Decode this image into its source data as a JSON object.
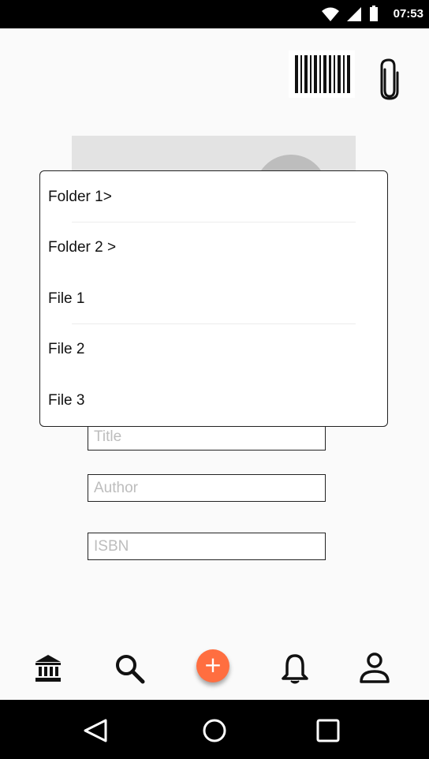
{
  "status_bar": {
    "time": "07:53",
    "icons": [
      "wifi-icon",
      "signal-icon",
      "battery-icon"
    ]
  },
  "top_actions": {
    "barcode_icon": "barcode-icon",
    "attach_icon": "paperclip-icon"
  },
  "dropdown_menu": {
    "items": [
      {
        "label": "Folder 1>"
      },
      {
        "label": "Folder 2 >"
      },
      {
        "label": "File 1"
      },
      {
        "label": "File 2"
      },
      {
        "label": "File 3"
      }
    ]
  },
  "form": {
    "title_placeholder": "Title",
    "author_placeholder": "Author",
    "isbn_placeholder": "ISBN"
  },
  "bottom_nav": {
    "items": [
      "library-icon",
      "search-icon",
      "add-icon",
      "bell-icon",
      "profile-icon"
    ],
    "fab_label": "+",
    "fab_color": "#ff6e40"
  },
  "system_nav": [
    "back-icon",
    "home-icon",
    "recents-icon"
  ]
}
